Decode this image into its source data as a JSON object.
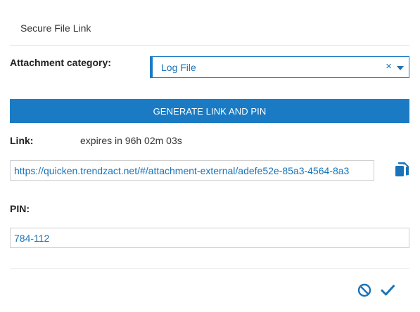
{
  "dialog": {
    "title": "Secure File Link"
  },
  "attachment": {
    "label": "Attachment category:",
    "selected_value": "Log File",
    "clear_glyph": "×"
  },
  "generate_button": {
    "label": "GENERATE LINK AND PIN"
  },
  "link": {
    "label": "Link:",
    "expiry_text": "expires in 96h 02m 03s",
    "url": "https://quicken.trendzact.net/#/attachment-external/adefe52e-85a3-4564-8a3"
  },
  "pin": {
    "label": "PIN:",
    "value": "784-112"
  },
  "icons": {
    "clear": "close-icon",
    "dropdown": "chevron-down-icon",
    "copy": "copy-icon",
    "cancel": "ban-icon",
    "confirm": "checkmark-icon"
  },
  "colors": {
    "accent": "#1a7bc4",
    "link_text": "#1a73b8",
    "label_text": "#222222",
    "border": "#cfcfcf"
  }
}
